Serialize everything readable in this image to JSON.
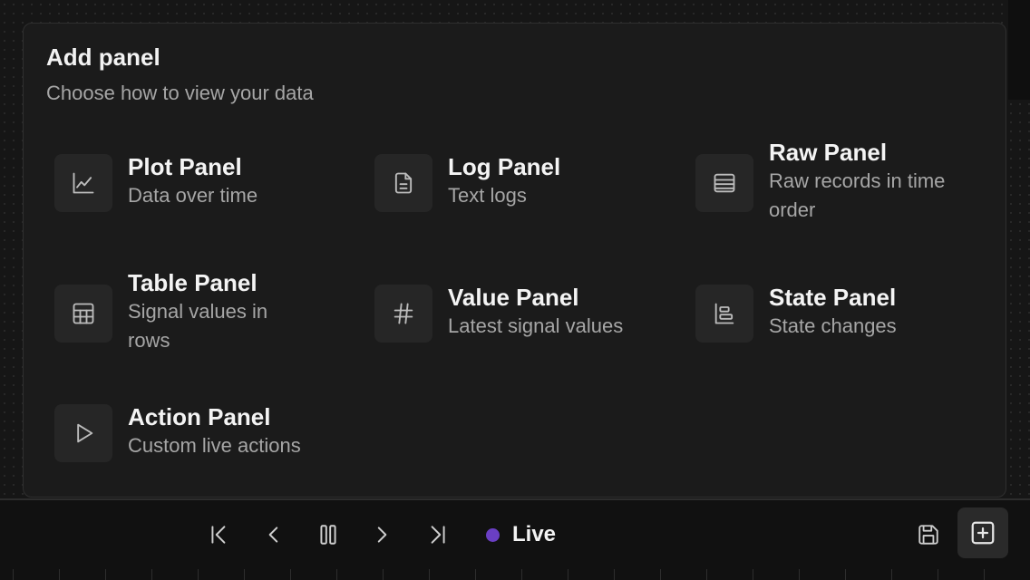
{
  "modal": {
    "title": "Add panel",
    "subtitle": "Choose how to view your data",
    "options": [
      {
        "name": "Plot Panel",
        "desc": "Data over time",
        "icon": "line-chart-icon"
      },
      {
        "name": "Log Panel",
        "desc": "Text logs",
        "icon": "document-icon"
      },
      {
        "name": "Raw Panel",
        "desc": "Raw records in time order",
        "icon": "list-rows-icon"
      },
      {
        "name": "Table Panel",
        "desc": "Signal values in rows",
        "icon": "table-grid-icon"
      },
      {
        "name": "Value Panel",
        "desc": "Latest signal values",
        "icon": "hash-icon"
      },
      {
        "name": "State Panel",
        "desc": "State changes",
        "icon": "state-timeline-icon"
      },
      {
        "name": "Action Panel",
        "desc": "Custom live actions",
        "icon": "play-icon"
      }
    ]
  },
  "toolbar": {
    "live_label": "Live",
    "live_color": "#6a3fc4",
    "buttons": [
      "skip-to-start-icon",
      "step-back-icon",
      "pause-icon",
      "step-forward-icon",
      "skip-to-end-icon",
      "save-icon",
      "add-square-icon"
    ]
  },
  "colors": {
    "background": "#161616",
    "modal": "#1b1b1b",
    "icon_tile": "#262626",
    "text_secondary": "#a6a6a6"
  }
}
